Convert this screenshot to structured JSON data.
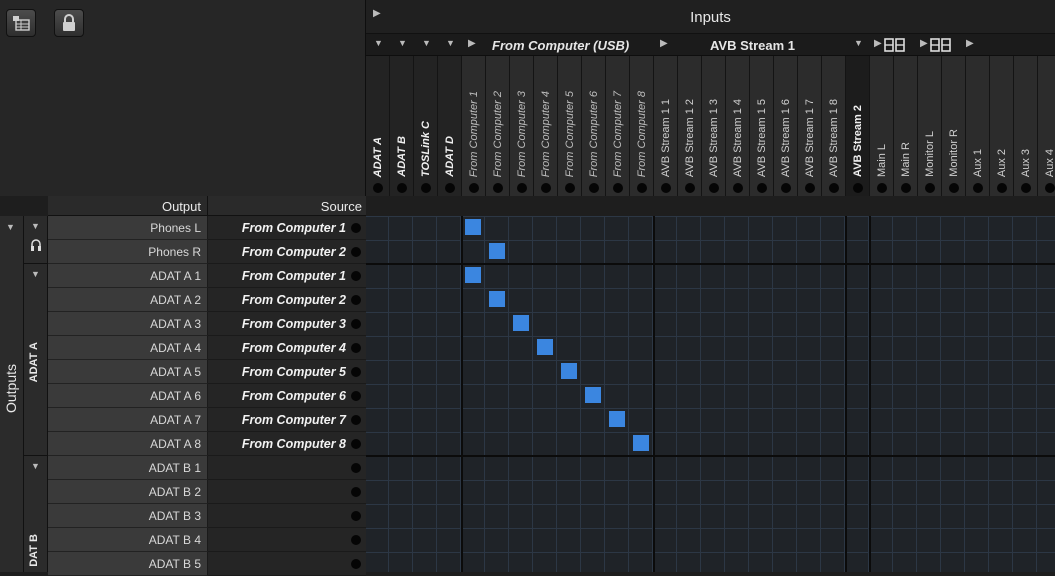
{
  "toolbar": {
    "routing_icon": "matrix-table-icon",
    "lock_icon": "lock-icon"
  },
  "inputs": {
    "title": "Inputs",
    "groups": {
      "usb": "From Computer (USB)",
      "avb": "AVB Stream 1"
    }
  },
  "columns": [
    {
      "label": "ADAT A",
      "style": "b"
    },
    {
      "label": "ADAT B",
      "style": "b"
    },
    {
      "label": "TOSLink C",
      "style": "b"
    },
    {
      "label": "ADAT D",
      "style": "b"
    },
    {
      "label": "From Computer 1",
      "style": "it"
    },
    {
      "label": "From Computer 2",
      "style": "it"
    },
    {
      "label": "From Computer 3",
      "style": "it"
    },
    {
      "label": "From Computer 4",
      "style": "it"
    },
    {
      "label": "From Computer 5",
      "style": "it"
    },
    {
      "label": "From Computer 6",
      "style": "it"
    },
    {
      "label": "From Computer 7",
      "style": "it"
    },
    {
      "label": "From Computer 8",
      "style": "it"
    },
    {
      "label": "AVB Stream 1 1",
      "style": ""
    },
    {
      "label": "AVB Stream 1 2",
      "style": ""
    },
    {
      "label": "AVB Stream 1 3",
      "style": ""
    },
    {
      "label": "AVB Stream 1 4",
      "style": ""
    },
    {
      "label": "AVB Stream 1 5",
      "style": ""
    },
    {
      "label": "AVB Stream 1 6",
      "style": ""
    },
    {
      "label": "AVB Stream 1 7",
      "style": ""
    },
    {
      "label": "AVB Stream 1 8",
      "style": ""
    },
    {
      "label": "AVB Stream 2",
      "style": "b2"
    },
    {
      "label": "Main L",
      "style": ""
    },
    {
      "label": "Main R",
      "style": ""
    },
    {
      "label": "Monitor L",
      "style": ""
    },
    {
      "label": "Monitor R",
      "style": ""
    },
    {
      "label": "Aux 1",
      "style": ""
    },
    {
      "label": "Aux 2",
      "style": ""
    },
    {
      "label": "Aux 3",
      "style": ""
    },
    {
      "label": "Aux 4",
      "style": ""
    }
  ],
  "table": {
    "output_header": "Output",
    "source_header": "Source"
  },
  "side": {
    "outputs_label": "Outputs",
    "adat_a_label": "ADAT A",
    "adat_b_label": "DAT B"
  },
  "rows": [
    {
      "output": "Phones L",
      "source": "From Computer 1",
      "col": 4
    },
    {
      "output": "Phones R",
      "source": "From Computer 2",
      "col": 5
    },
    {
      "output": "ADAT A 1",
      "source": "From Computer 1",
      "col": 4
    },
    {
      "output": "ADAT A 2",
      "source": "From Computer 2",
      "col": 5
    },
    {
      "output": "ADAT A 3",
      "source": "From Computer 3",
      "col": 6
    },
    {
      "output": "ADAT A 4",
      "source": "From Computer 4",
      "col": 7
    },
    {
      "output": "ADAT A 5",
      "source": "From Computer 5",
      "col": 8
    },
    {
      "output": "ADAT A 6",
      "source": "From Computer 6",
      "col": 9
    },
    {
      "output": "ADAT A 7",
      "source": "From Computer 7",
      "col": 10
    },
    {
      "output": "ADAT A 8",
      "source": "From Computer 8",
      "col": 11
    },
    {
      "output": "ADAT B 1",
      "source": "",
      "col": -1
    },
    {
      "output": "ADAT B 2",
      "source": "",
      "col": -1
    },
    {
      "output": "ADAT B 3",
      "source": "",
      "col": -1
    },
    {
      "output": "ADAT B 4",
      "source": "",
      "col": -1
    },
    {
      "output": "ADAT B 5",
      "source": "",
      "col": -1
    }
  ]
}
